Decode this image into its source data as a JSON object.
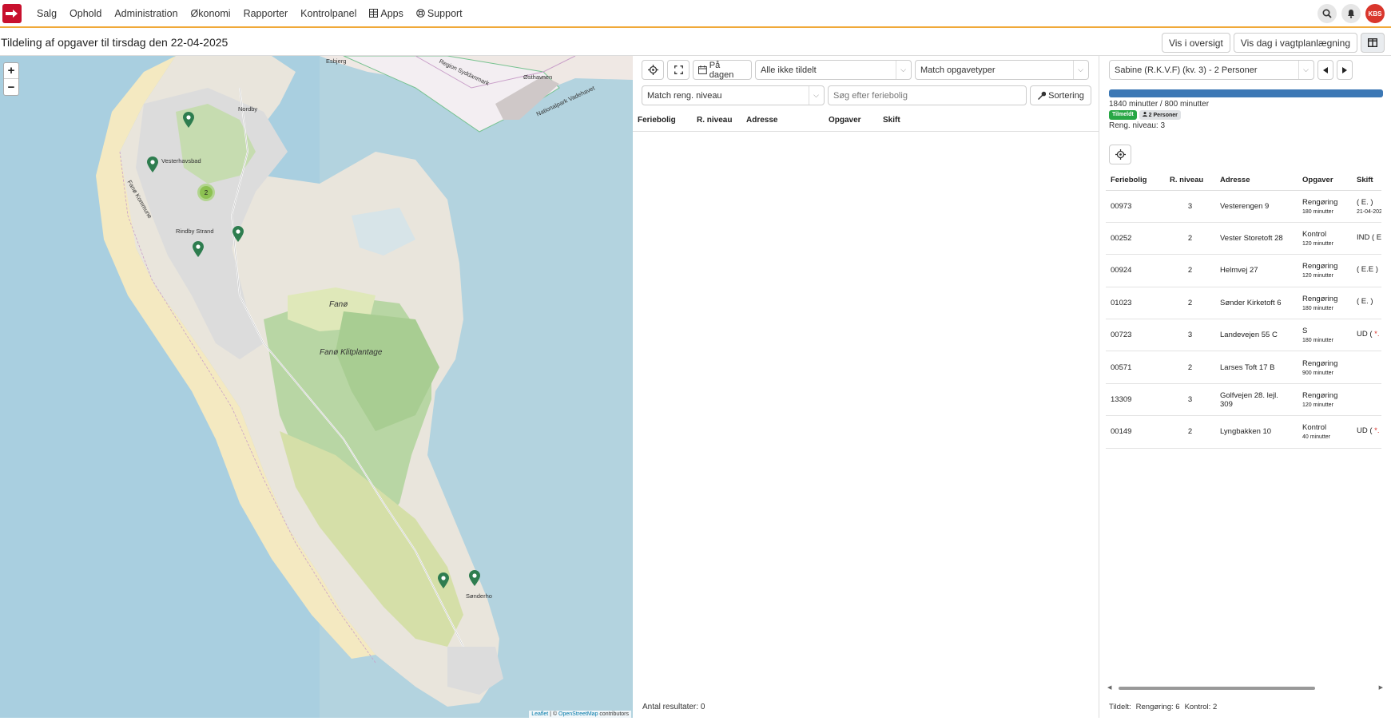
{
  "nav": {
    "items": [
      "Salg",
      "Ophold",
      "Administration",
      "Økonomi",
      "Rapporter",
      "Kontrolpanel",
      "Apps",
      "Support"
    ],
    "avatar_initials": "KBS"
  },
  "header": {
    "title": "Tildeling af opgaver til tirsdag den 22-04-2025",
    "btn_overview": "Vis i oversigt",
    "btn_day_plan": "Vis dag i vagtplanlægning"
  },
  "map": {
    "labels": {
      "nordby": "Nordby",
      "vesterhavsbad": "Vesterhavsbad",
      "rindby": "Rindby Strand",
      "fano": "Fanø",
      "klitplantage": "Fanø Klitplantage",
      "sonderho": "Sønderho",
      "esbjerg": "Esbjerg",
      "havn": "Østhavnen",
      "region": "Region Syddanmark",
      "kommune": "Fanø Kommune",
      "natpark": "Nationalpark Vadehavet"
    },
    "cluster_count": "2",
    "zoom_in": "+",
    "zoom_out": "−",
    "attribution": {
      "leaflet": "Leaflet",
      "sep": " | © ",
      "osm": "OpenStreetMap",
      "contrib": " contributors"
    }
  },
  "mid": {
    "btn_day": "På dagen",
    "select_assign": "Alle ikke tildelt",
    "select_types": "Match opgavetyper",
    "select_level": "Match reng. niveau",
    "search_placeholder": "Søg efter feriebolig",
    "btn_sort": "Sortering",
    "columns": [
      "Feriebolig",
      "R. niveau",
      "Adresse",
      "Opgaver",
      "Skift"
    ],
    "footer": "Antal resultater: 0"
  },
  "right": {
    "person_select": "Sabine (R.K.V.F) (kv. 3) - 2 Personer",
    "minutes": "1840 minutter / 800 minutter",
    "progress_percent": 100,
    "badge_status": "Tilmeldt",
    "badge_persons": "2 Personer",
    "reng_level": "Reng. niveau: 3",
    "columns": [
      "Feriebolig",
      "R. niveau",
      "Adresse",
      "Opgaver",
      "Skift"
    ],
    "rows": [
      {
        "id": "00973",
        "level": "3",
        "address": "Vesterengen 9",
        "task": "Rengøring",
        "mins": "180 minutter",
        "shift": "( E. )",
        "shift_note": "21-04-202"
      },
      {
        "id": "00252",
        "level": "2",
        "address": "Vester Storetoft 28",
        "task": "Kontrol",
        "mins": "120 minutter",
        "shift": "IND ( E.*",
        "shift_note": ""
      },
      {
        "id": "00924",
        "level": "2",
        "address": "Helmvej 27",
        "task": "Rengøring",
        "mins": "120 minutter",
        "shift": "( E.E )",
        "shift_note": ""
      },
      {
        "id": "01023",
        "level": "2",
        "address": "Sønder Kirketoft 6",
        "task": "Rengøring",
        "mins": "180 minutter",
        "shift": "( E. )",
        "shift_note": ""
      },
      {
        "id": "00723",
        "level": "3",
        "address": "Landevejen 55 C",
        "task": "S",
        "mins": "180 minutter",
        "shift": "UD ( *. )",
        "shift_note": ""
      },
      {
        "id": "00571",
        "level": "2",
        "address": "Larses Toft 17 B",
        "task": "Rengøring",
        "mins": "900 minutter",
        "shift": "",
        "shift_note": ""
      },
      {
        "id": "13309",
        "level": "3",
        "address": "Golfvejen 28. lejl. 309",
        "task": "Rengøring",
        "mins": "120 minutter",
        "shift": "",
        "shift_note": ""
      },
      {
        "id": "00149",
        "level": "2",
        "address": "Lyngbakken 10",
        "task": "Kontrol",
        "mins": "40 minutter",
        "shift": "UD ( *. )",
        "shift_note": ""
      }
    ],
    "footer": {
      "label": "Tildelt:",
      "cleaning": "Rengøring: 6",
      "control": "Kontrol: 2"
    }
  },
  "colors": {
    "accent": "#f0a93a",
    "brand": "#c8102e",
    "progress": "#3c78b5",
    "pin": "#2e7d4f"
  }
}
